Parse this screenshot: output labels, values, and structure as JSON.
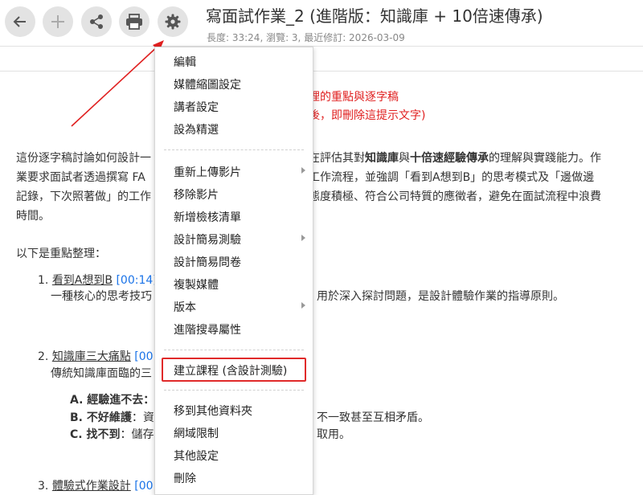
{
  "header": {
    "title": "寫面試作業_2 (進階版：知識庫 + 10倍速傳承)",
    "meta": "長度: 33:24, 瀏覽: 3, 最近修訂: 2026-03-09",
    "buttons": [
      "back-icon",
      "plus-icon",
      "share-icon",
      "print-icon",
      "gear-icon"
    ]
  },
  "notice": {
    "line1": "理的重點與逐字稿",
    "line2": "後，即刪除這提示文字)"
  },
  "content": {
    "p1": "這份逐字稿討論如何設計一",
    "p1b": "在評估其對",
    "p1c": "知識庫",
    "p1d": "與",
    "p1e": "十倍速經驗傳承",
    "p1f": "的理解與實踐能力。作",
    "p2a": "業要求面試者透過撰寫 FA",
    "p2b": "工作流程，並強調「看到A想到B」的思考模式及「邊做邊",
    "p3a": "記錄，下次照著做」的工作",
    "p3b": "態度積極、符合公司特質的應徵者，避免在面試流程中浪費",
    "p4": "時間。",
    "summary": "以下是重點整理：",
    "items": [
      {
        "num": "1.",
        "title": "看到A想到B",
        "ts": "[00:14]",
        "desc_a": "一種核心的思考技巧",
        "desc_b": "用於深入探討問題，是設計體驗作業的指導原則。"
      },
      {
        "num": "2.",
        "title": "知識庫三大痛點",
        "ts": "[00",
        "desc_a": "傳統知識庫面臨的三"
      },
      {
        "num": "3.",
        "title": "體驗式作業設計",
        "ts": "[00"
      }
    ],
    "sub": [
      {
        "label": "A. 經驗進不去：",
        "tail": ""
      },
      {
        "label": "B. 不好維護：資",
        "tail": "不一致甚至互相矛盾。"
      },
      {
        "label": "C. 找不到：儲存",
        "tail": "取用。"
      }
    ]
  },
  "menu": {
    "items": [
      {
        "label": "編輯"
      },
      {
        "label": "媒體縮圖設定"
      },
      {
        "label": "講者設定"
      },
      {
        "label": "設為精選"
      },
      {
        "label": "重新上傳影片",
        "submenu": true
      },
      {
        "label": "移除影片"
      },
      {
        "label": "新增檢核清單"
      },
      {
        "label": "設計簡易測驗",
        "submenu": true
      },
      {
        "label": "設計簡易問卷"
      },
      {
        "label": "複製媒體"
      },
      {
        "label": "版本",
        "submenu": true
      },
      {
        "label": "進階搜尋屬性"
      },
      {
        "label": "建立課程 (含設計測驗)",
        "highlighted": true
      },
      {
        "label": "移到其他資料夾"
      },
      {
        "label": "網域限制"
      },
      {
        "label": "其他設定"
      },
      {
        "label": "刪除"
      }
    ]
  },
  "colors": {
    "accent": "#e02020",
    "link": "#1a73e8"
  }
}
